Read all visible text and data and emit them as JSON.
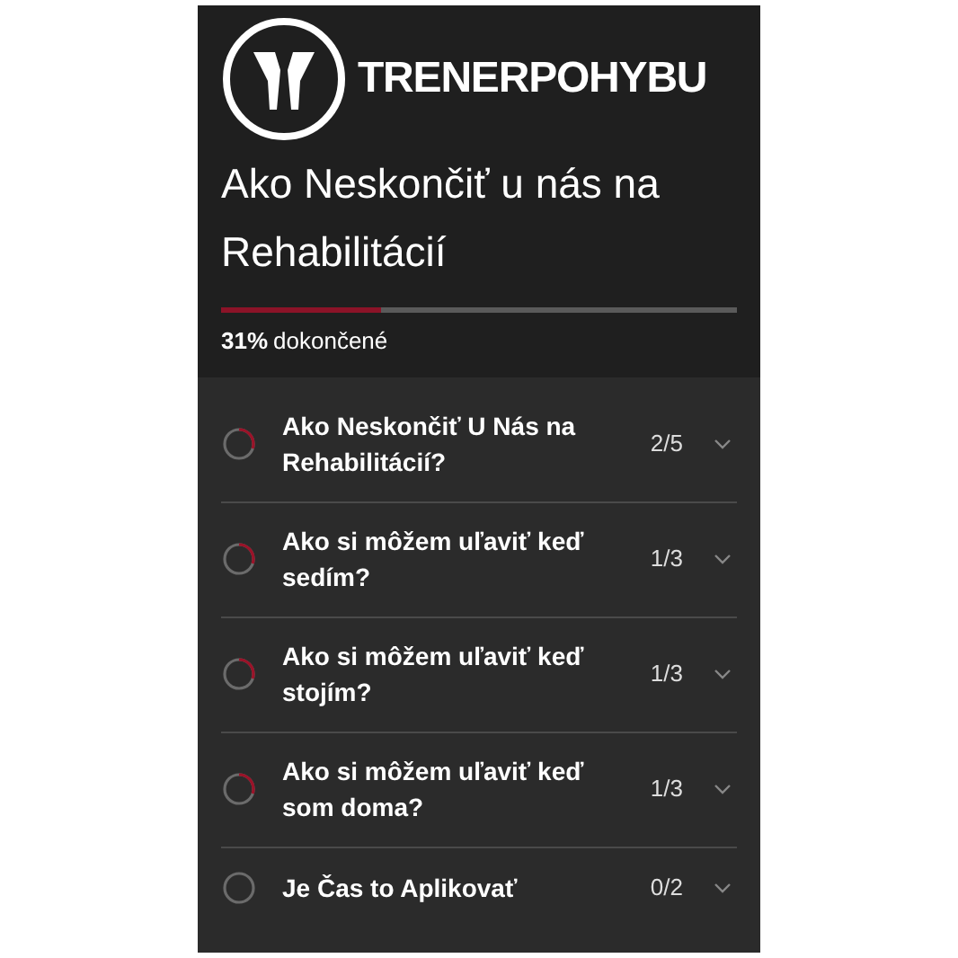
{
  "brand": "TRENERPOHYBU",
  "course": {
    "title": "Ako Neskončiť u nás na Rehabilitácií",
    "progress": {
      "level": 0.31,
      "percent": "31%",
      "label": "dokončené"
    }
  },
  "sections": [
    {
      "title": "Ako Neskončiť U Nás na Rehabilitácií?",
      "count": "2/5",
      "started": true
    },
    {
      "title": "Ako si môžem uľaviť keď sedím?",
      "count": "1/3",
      "started": true
    },
    {
      "title": "Ako si môžem uľaviť keď stojím?",
      "count": "1/3",
      "started": true
    },
    {
      "title": "Ako si môžem uľaviť keď som doma?",
      "count": "1/3",
      "started": true
    },
    {
      "title": "Je Čas to Aplikovať",
      "count": "0/2",
      "started": false
    }
  ]
}
